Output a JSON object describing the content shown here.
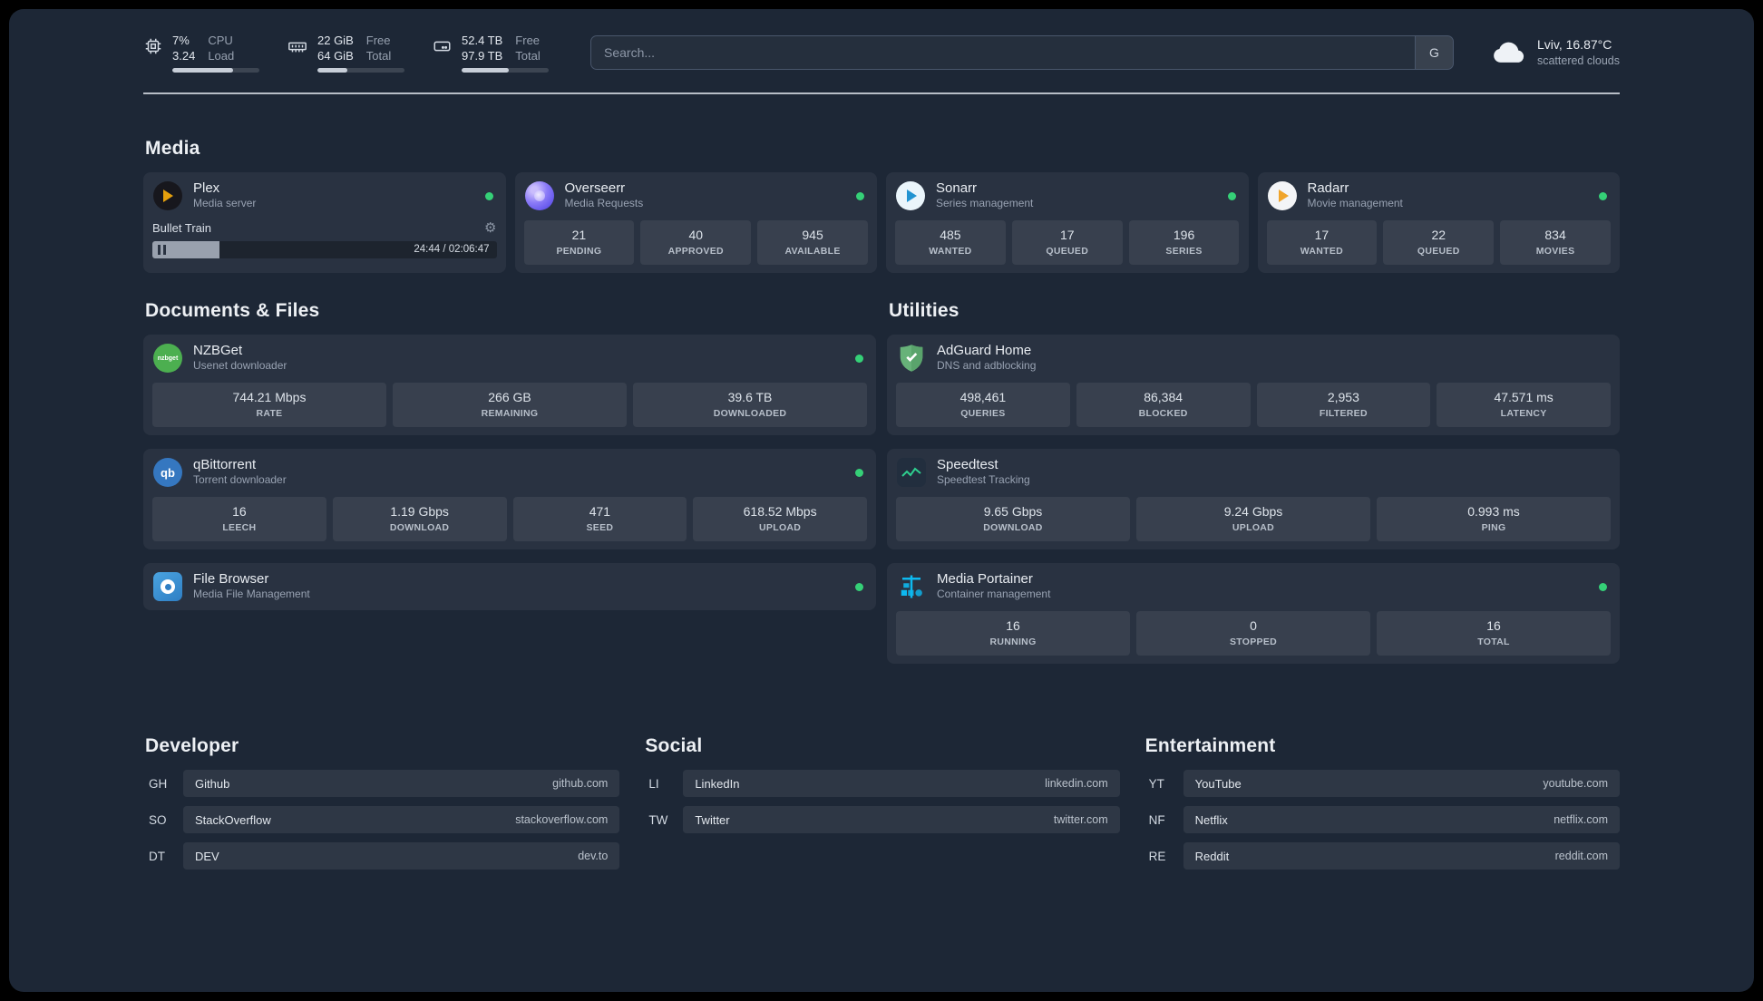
{
  "topbar": {
    "cpu": {
      "value_top": "7%",
      "value_bottom": "3.24",
      "label_top": "CPU",
      "label_bottom": "Load",
      "percent": 70
    },
    "memory": {
      "value_top": "22 GiB",
      "value_bottom": "64 GiB",
      "label_top": "Free",
      "label_bottom": "Total",
      "percent": 34
    },
    "disk": {
      "value_top": "52.4 TB",
      "value_bottom": "97.9 TB",
      "label_top": "Free",
      "label_bottom": "Total",
      "percent": 54
    },
    "search": {
      "placeholder": "Search...",
      "engine_button": "G"
    },
    "weather": {
      "location": "Lviv, 16.87°C",
      "condition": "scattered clouds"
    }
  },
  "sections": {
    "media": "Media",
    "documents": "Documents & Files",
    "utilities": "Utilities",
    "developer": "Developer",
    "social": "Social",
    "entertainment": "Entertainment"
  },
  "services": {
    "plex": {
      "name": "Plex",
      "subtitle": "Media server",
      "player": {
        "track": "Bullet Train",
        "time": "24:44 / 02:06:47",
        "progress_percent": 19.5
      }
    },
    "overseerr": {
      "name": "Overseerr",
      "subtitle": "Media Requests",
      "stats": [
        {
          "value": "21",
          "label": "PENDING"
        },
        {
          "value": "40",
          "label": "APPROVED"
        },
        {
          "value": "945",
          "label": "AVAILABLE"
        }
      ]
    },
    "sonarr": {
      "name": "Sonarr",
      "subtitle": "Series management",
      "stats": [
        {
          "value": "485",
          "label": "WANTED"
        },
        {
          "value": "17",
          "label": "QUEUED"
        },
        {
          "value": "196",
          "label": "SERIES"
        }
      ]
    },
    "radarr": {
      "name": "Radarr",
      "subtitle": "Movie management",
      "stats": [
        {
          "value": "17",
          "label": "WANTED"
        },
        {
          "value": "22",
          "label": "QUEUED"
        },
        {
          "value": "834",
          "label": "MOVIES"
        }
      ]
    },
    "nzbget": {
      "name": "NZBGet",
      "subtitle": "Usenet downloader",
      "stats": [
        {
          "value": "744.21 Mbps",
          "label": "RATE"
        },
        {
          "value": "266 GB",
          "label": "REMAINING"
        },
        {
          "value": "39.6 TB",
          "label": "DOWNLOADED"
        }
      ]
    },
    "qbittorrent": {
      "name": "qBittorrent",
      "subtitle": "Torrent downloader",
      "stats": [
        {
          "value": "16",
          "label": "LEECH"
        },
        {
          "value": "1.19 Gbps",
          "label": "DOWNLOAD"
        },
        {
          "value": "471",
          "label": "SEED"
        },
        {
          "value": "618.52 Mbps",
          "label": "UPLOAD"
        }
      ]
    },
    "filebrowser": {
      "name": "File Browser",
      "subtitle": "Media File Management"
    },
    "adguard": {
      "name": "AdGuard Home",
      "subtitle": "DNS and adblocking",
      "stats": [
        {
          "value": "498,461",
          "label": "QUERIES"
        },
        {
          "value": "86,384",
          "label": "BLOCKED"
        },
        {
          "value": "2,953",
          "label": "FILTERED"
        },
        {
          "value": "47.571 ms",
          "label": "LATENCY"
        }
      ]
    },
    "speedtest": {
      "name": "Speedtest",
      "subtitle": "Speedtest Tracking",
      "stats": [
        {
          "value": "9.65 Gbps",
          "label": "DOWNLOAD"
        },
        {
          "value": "9.24 Gbps",
          "label": "UPLOAD"
        },
        {
          "value": "0.993 ms",
          "label": "PING"
        }
      ]
    },
    "portainer": {
      "name": "Media Portainer",
      "subtitle": "Container management",
      "stats": [
        {
          "value": "16",
          "label": "RUNNING"
        },
        {
          "value": "0",
          "label": "STOPPED"
        },
        {
          "value": "16",
          "label": "TOTAL"
        }
      ]
    }
  },
  "bookmarks": {
    "developer": [
      {
        "abbr": "GH",
        "name": "Github",
        "url": "github.com"
      },
      {
        "abbr": "SO",
        "name": "StackOverflow",
        "url": "stackoverflow.com"
      },
      {
        "abbr": "DT",
        "name": "DEV",
        "url": "dev.to"
      }
    ],
    "social": [
      {
        "abbr": "LI",
        "name": "LinkedIn",
        "url": "linkedin.com"
      },
      {
        "abbr": "TW",
        "name": "Twitter",
        "url": "twitter.com"
      }
    ],
    "entertainment": [
      {
        "abbr": "YT",
        "name": "YouTube",
        "url": "youtube.com"
      },
      {
        "abbr": "NF",
        "name": "Netflix",
        "url": "netflix.com"
      },
      {
        "abbr": "RE",
        "name": "Reddit",
        "url": "reddit.com"
      }
    ]
  }
}
